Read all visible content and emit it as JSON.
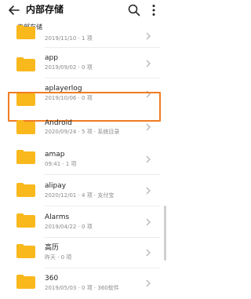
{
  "header": {
    "title": "内部存储",
    "back_icon": "arrow-left-icon",
    "search_icon": "search-icon",
    "more_icon": "more-vertical-icon"
  },
  "breadcrumb": "内部存储",
  "colors": {
    "folder": "#f9b81c",
    "highlight": "#f07c22",
    "meta": "#8a8a8a"
  },
  "items": [
    {
      "name": "",
      "meta": "2019/11/10 · 1 项"
    },
    {
      "name": "app",
      "meta": "2019/09/02 · 0 项"
    },
    {
      "name": "aplayerlog",
      "meta": "2019/10/06 · 0 项"
    },
    {
      "name": "Android",
      "meta": "2020/09/24 · 5 项 · 系统目录"
    },
    {
      "name": "amap",
      "meta": "09:41 · 1 项"
    },
    {
      "name": "alipay",
      "meta": "2020/12/01 · 4 项 · 支付宝"
    },
    {
      "name": "Alarms",
      "meta": "2019/04/22 · 0 项"
    },
    {
      "name": "高历",
      "meta": "昨天 · 0 项"
    },
    {
      "name": "360",
      "meta": "2019/05/03 · 0 项 · 360软件"
    }
  ]
}
